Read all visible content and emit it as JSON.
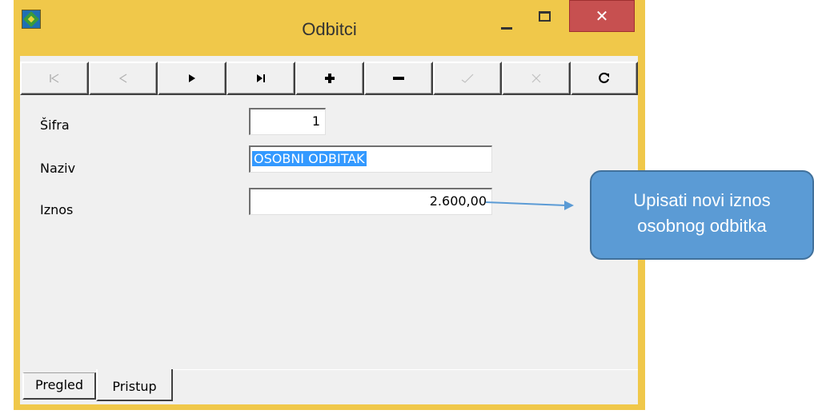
{
  "window": {
    "title": "Odbitci",
    "close_glyph": "✕"
  },
  "toolbar": {
    "buttons": [
      {
        "name": "first-record",
        "icon": "first-icon",
        "enabled": false
      },
      {
        "name": "prior-record",
        "icon": "prior-icon",
        "enabled": false
      },
      {
        "name": "next-record",
        "icon": "next-icon",
        "enabled": true
      },
      {
        "name": "last-record",
        "icon": "last-icon",
        "enabled": true
      },
      {
        "name": "insert-record",
        "icon": "plus-icon",
        "enabled": true
      },
      {
        "name": "delete-record",
        "icon": "minus-icon",
        "enabled": true
      },
      {
        "name": "post-edit",
        "icon": "check-icon",
        "enabled": false
      },
      {
        "name": "cancel-edit",
        "icon": "cancel-icon",
        "enabled": false
      },
      {
        "name": "refresh-data",
        "icon": "refresh-icon",
        "enabled": true
      }
    ]
  },
  "form": {
    "sifra_label": "Šifra",
    "sifra_value": "1",
    "naziv_label": "Naziv",
    "naziv_value": "OSOBNI ODBITAK",
    "iznos_label": "Iznos",
    "iznos_value": "2.600,00"
  },
  "tabs": {
    "pregled": "Pregled",
    "pristup": "Pristup",
    "active": "Pristup"
  },
  "callout": {
    "line1": "Upisati novi iznos",
    "line2": "osobnog odbitka"
  },
  "colors": {
    "titlebar": "#f0c84a",
    "close_button": "#c75050",
    "callout_fill": "#5b9bd5",
    "selection": "#3399ff"
  }
}
